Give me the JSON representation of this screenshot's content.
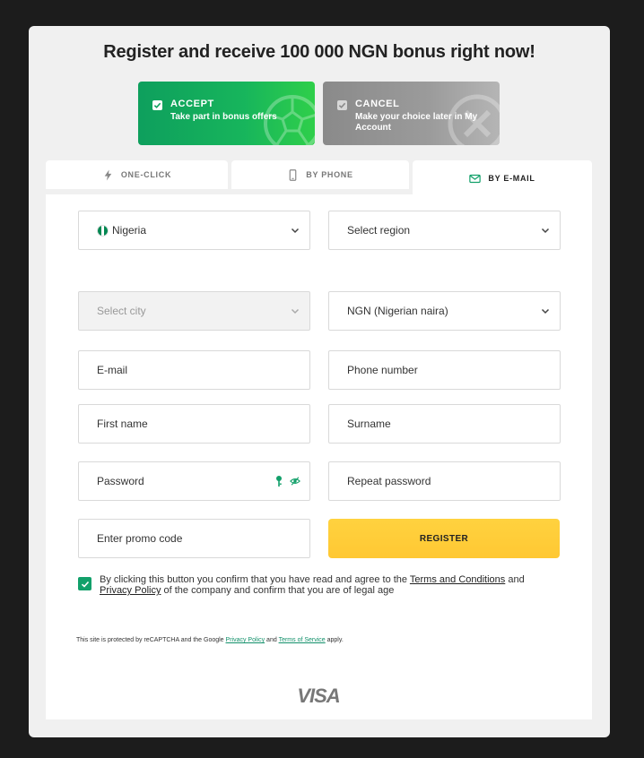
{
  "headline": "Register and receive 100 000 NGN bonus right now!",
  "bonus": {
    "accept": {
      "title": "ACCEPT",
      "subtitle": "Take part in bonus offers"
    },
    "cancel": {
      "title": "CANCEL",
      "subtitle": "Make your choice later in My Account"
    }
  },
  "tabs": [
    {
      "label": "ONE-CLICK",
      "icon": "lightning-icon",
      "active": false
    },
    {
      "label": "BY PHONE",
      "icon": "phone-icon",
      "active": false
    },
    {
      "label": "BY E-MAIL",
      "icon": "envelope-icon",
      "active": true
    }
  ],
  "form": {
    "country": "Nigeria",
    "region": "Select region",
    "city": "Select city",
    "currency": "NGN (Nigerian naira)",
    "email": "E-mail",
    "phone": "Phone number",
    "first_name": "First name",
    "surname": "Surname",
    "password": "Password",
    "repeat_password": "Repeat password",
    "promo": "Enter promo code",
    "register_label": "REGISTER"
  },
  "agreement": {
    "before": "By clicking this button you confirm that you have read and agree to the ",
    "terms_link": "Terms and Conditions",
    "and": " and ",
    "privacy_link": "Privacy Policy",
    "after": " of the company and confirm that you are of legal age"
  },
  "recaptcha": {
    "before": "This site is protected by reCAPTCHA and the Google ",
    "privacy_link": "Privacy Policy",
    "and": " and ",
    "terms_link": "Terms of Service",
    "after": " apply."
  },
  "payment_logo": "VISA",
  "colors": {
    "accent_green": "#12a06a",
    "register_yellow": "#ffcc33",
    "flag_green": "#008751"
  }
}
